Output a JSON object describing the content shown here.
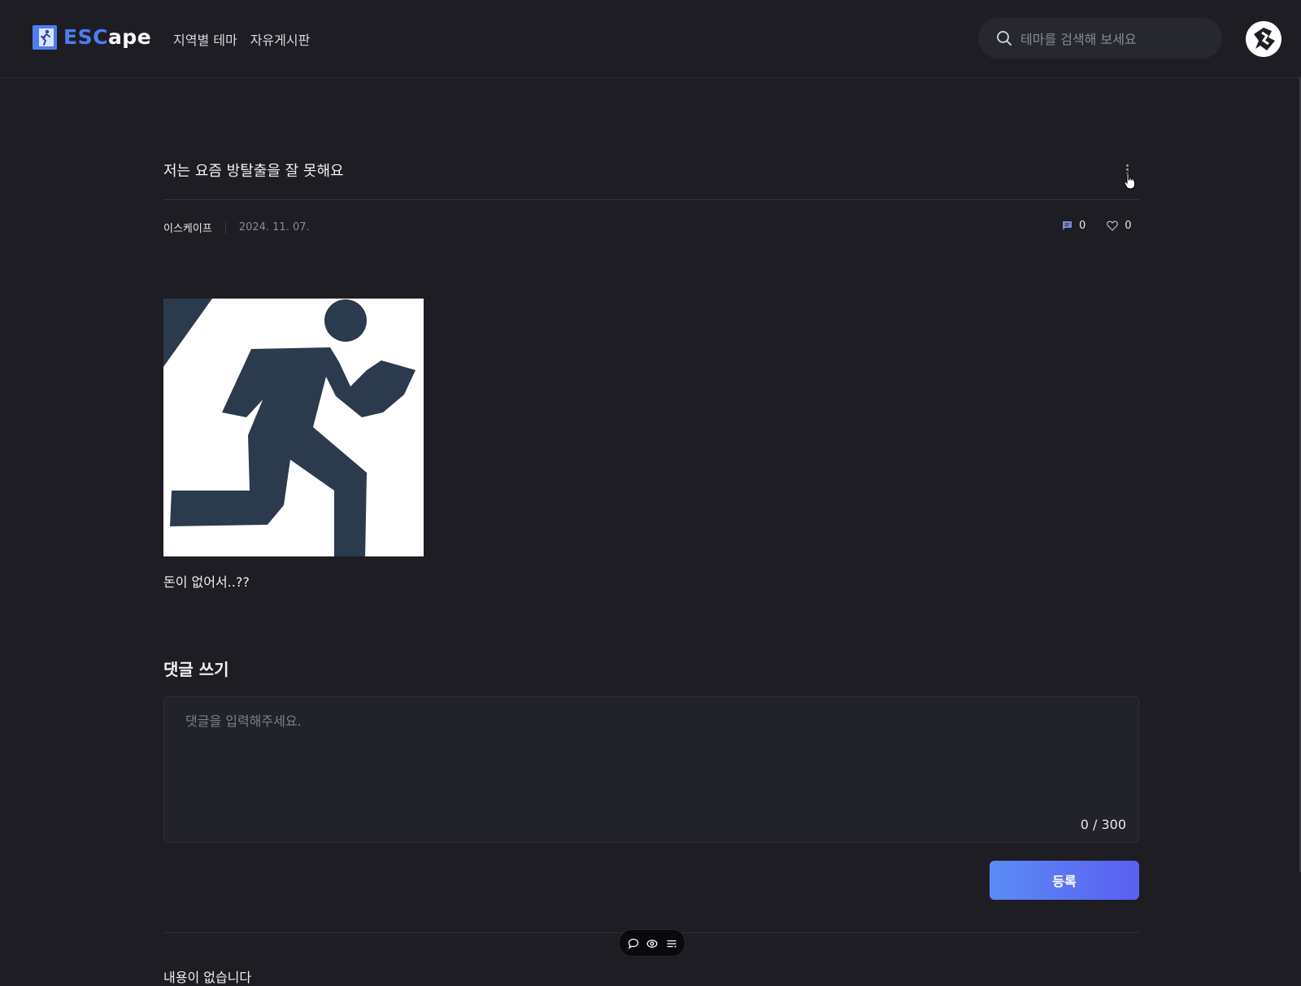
{
  "header": {
    "logo_part1": "ESC",
    "logo_part2": "ape",
    "nav": [
      "지역별 테마",
      "자유게시판"
    ],
    "search_placeholder": "테마를 검색해 보세요"
  },
  "post": {
    "title": "저는 요즘 방탈출을 잘 못해요",
    "author": "이스케이프",
    "date": "2024. 11. 07.",
    "comment_count": "0",
    "like_count": "0",
    "body": "돈이 없어서..??"
  },
  "comments": {
    "heading": "댓글 쓰기",
    "placeholder": "댓글을 입력해주세요.",
    "counter": "0 / 300",
    "submit_label": "등록",
    "empty_text": "내용이 없습니다"
  },
  "icons": {
    "logo": "running-man-icon",
    "search": "search-icon",
    "more": "kebab-menu-icon",
    "comment": "comment-icon",
    "like": "heart-icon",
    "toolbar": [
      "chat-bubble-icon",
      "eye-icon",
      "list-icon"
    ]
  },
  "colors": {
    "background": "#1d1d23",
    "accent": "#4f7df0",
    "button_gradient_start": "#5b8bf5",
    "button_gradient_end": "#5a5ff0"
  }
}
